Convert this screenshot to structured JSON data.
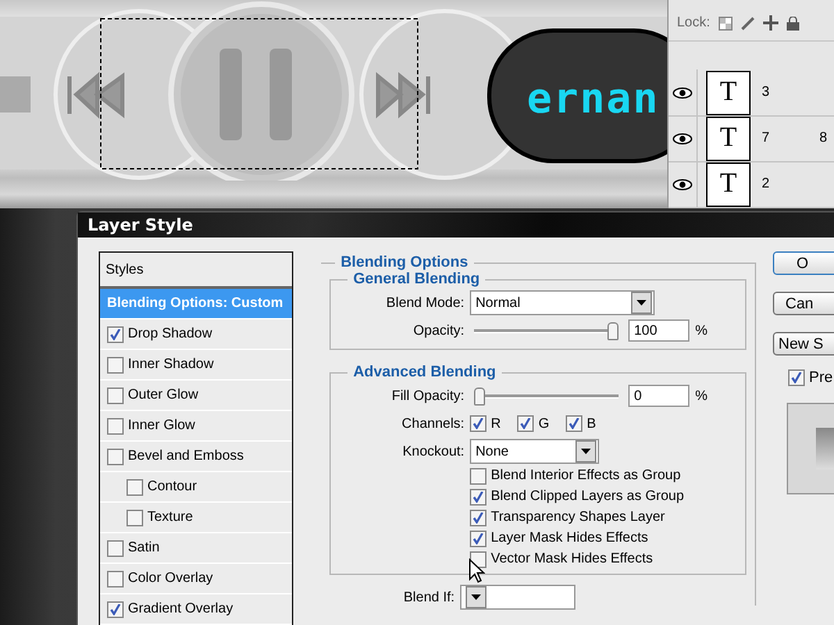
{
  "canvas": {
    "display_text": "ernan"
  },
  "layers_panel": {
    "lock_label": "Lock:",
    "layers": [
      {
        "name": "3",
        "visible": true,
        "thumbnail_text": "T"
      },
      {
        "name": "7",
        "visible": true,
        "thumbnail_text": "T",
        "column_2": "8"
      },
      {
        "name": "2",
        "visible": true,
        "thumbnail_text": "T"
      }
    ]
  },
  "dialog": {
    "title": "Layer Style",
    "styles_header": "Styles",
    "styles": [
      {
        "kind": "header",
        "label": "Blending Options: Custom",
        "selected": true
      },
      {
        "kind": "effect",
        "label": "Drop Shadow",
        "checked": true,
        "selected": false
      },
      {
        "kind": "effect",
        "label": "Inner Shadow",
        "checked": false,
        "selected": false
      },
      {
        "kind": "effect",
        "label": "Outer Glow",
        "checked": false,
        "selected": false
      },
      {
        "kind": "effect",
        "label": "Inner Glow",
        "checked": false,
        "selected": false
      },
      {
        "kind": "effect",
        "label": "Bevel and Emboss",
        "checked": false,
        "selected": false
      },
      {
        "kind": "sub",
        "label": "Contour",
        "checked": false,
        "selected": false
      },
      {
        "kind": "sub",
        "label": "Texture",
        "checked": false,
        "selected": false
      },
      {
        "kind": "effect",
        "label": "Satin",
        "checked": false,
        "selected": false
      },
      {
        "kind": "effect",
        "label": "Color Overlay",
        "checked": false,
        "selected": false
      },
      {
        "kind": "effect",
        "label": "Gradient Overlay",
        "checked": true,
        "selected": false
      }
    ],
    "blending_options": {
      "title": "Blending Options",
      "general": {
        "title": "General Blending",
        "blend_mode_label": "Blend Mode:",
        "blend_mode": "Normal",
        "opacity_label": "Opacity:",
        "opacity_slider": {
          "level": 1
        },
        "opacity_value": "100",
        "opacity_unit": "%"
      },
      "advanced": {
        "title": "Advanced Blending",
        "fill_opacity_label": "Fill Opacity:",
        "fill_opacity_slider": {
          "level": 0
        },
        "fill_opacity_value": "0",
        "fill_opacity_unit": "%",
        "channels_label": "Channels:",
        "channels": [
          {
            "label": "R",
            "checked": true
          },
          {
            "label": "G",
            "checked": true
          },
          {
            "label": "B",
            "checked": true
          }
        ],
        "knockout_label": "Knockout:",
        "knockout": "None",
        "options": [
          {
            "label": "Blend Interior Effects as Group",
            "checked": false
          },
          {
            "label": "Blend Clipped Layers as Group",
            "checked": true
          },
          {
            "label": "Transparency Shapes Layer",
            "checked": true
          },
          {
            "label": "Layer Mask Hides Effects",
            "checked": true
          },
          {
            "label": "Vector Mask Hides Effects",
            "checked": false
          }
        ]
      },
      "blend_if_label": "Blend If:"
    },
    "buttons": [
      {
        "label": "O",
        "default": true
      },
      {
        "label": "Can",
        "default": false
      },
      {
        "label": "New S",
        "default": false
      }
    ],
    "preview": {
      "label": "Pre",
      "checked": true
    }
  }
}
